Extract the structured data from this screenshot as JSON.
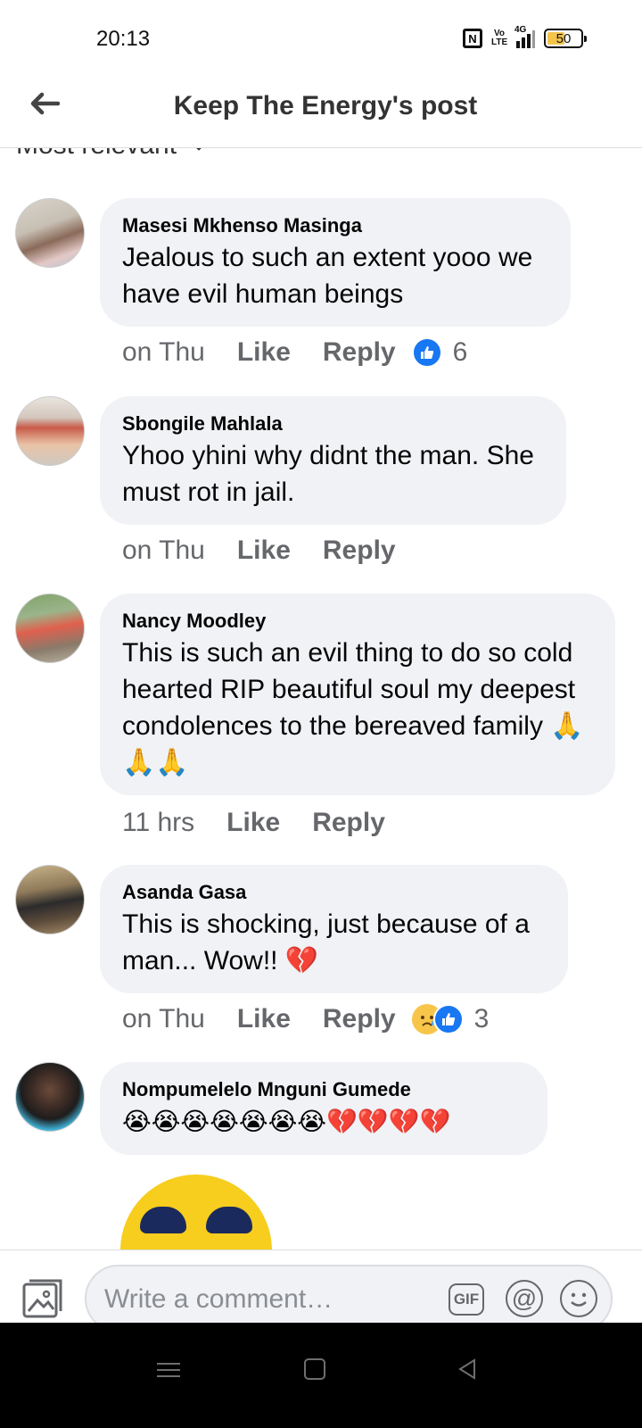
{
  "status_bar": {
    "time": "20:13",
    "nfc": "N",
    "volte": "Vo LTE",
    "network": "4G",
    "battery": "50"
  },
  "header": {
    "title": "Keep The Energy's post",
    "back_icon": "arrow-left-icon"
  },
  "sort": {
    "label": "Most relevant"
  },
  "comments": [
    {
      "author": "Masesi Mkhenso Masinga",
      "text": "Jealous to such an extent yooo we have evil human beings",
      "time": "on Thu",
      "like_label": "Like",
      "reply_label": "Reply",
      "reaction_count": "6",
      "reactions": [
        "like"
      ]
    },
    {
      "author": "Sbongile Mahlala",
      "text": "Yhoo yhini why didnt the man. She must rot in jail.",
      "time": "on Thu",
      "like_label": "Like",
      "reply_label": "Reply"
    },
    {
      "author": "Nancy Moodley",
      "text": "This is such an evil thing to do so cold hearted RIP beautiful soul my deepest condolences to the bereaved family 🙏🙏🙏",
      "time": "11 hrs",
      "like_label": "Like",
      "reply_label": "Reply"
    },
    {
      "author": "Asanda Gasa",
      "text": "This is shocking, just because of a man... Wow!! 💔",
      "time": "on Thu",
      "like_label": "Like",
      "reply_label": "Reply",
      "reaction_count": "3",
      "reactions": [
        "sad",
        "like"
      ]
    },
    {
      "author": "Nompumelelo Mnguni Gumede",
      "text": "😭😭😭😭😭😭😭💔💔💔💔"
    }
  ],
  "composer": {
    "placeholder": "Write a comment…",
    "gif_label": "GIF",
    "at_label": "@"
  },
  "colors": {
    "accent": "#1877f2",
    "bubble": "#f0f2f5",
    "secondary_text": "#65676b"
  }
}
